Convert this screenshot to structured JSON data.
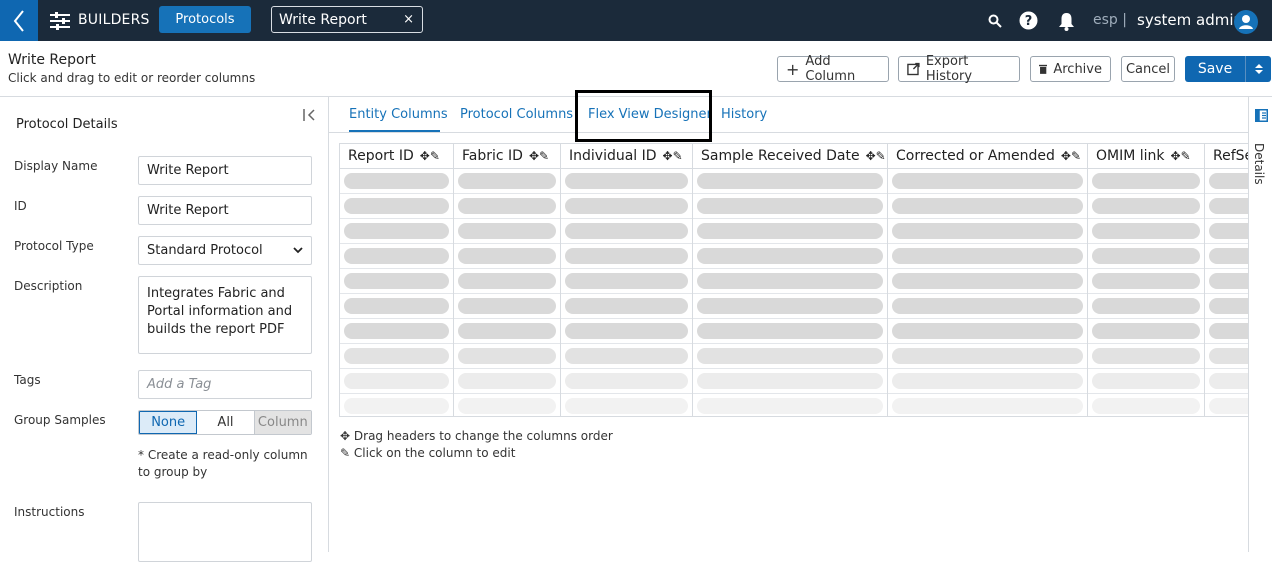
{
  "topbar": {
    "brand": "BUILDERS",
    "section_pill": "Protocols",
    "open_tab": "Write Report",
    "close_glyph": "×",
    "lang": "esp |",
    "user": "system admin",
    "colors": {
      "bar": "#1b2a3a",
      "accent": "#0f67b1"
    }
  },
  "header": {
    "title": "Write Report",
    "subtitle": "Click and drag to edit or reorder columns",
    "buttons": {
      "add_column": "Add Column",
      "export_history": "Export History",
      "archive": "Archive",
      "cancel": "Cancel",
      "save": "Save"
    }
  },
  "details": {
    "heading": "Protocol Details",
    "display_name_label": "Display Name",
    "display_name_value": "Write Report",
    "id_label": "ID",
    "id_value": "Write Report",
    "protocol_type_label": "Protocol Type",
    "protocol_type_value": "Standard Protocol",
    "description_label": "Description",
    "description_value": "Integrates Fabric and Portal information and builds the report PDF",
    "tags_label": "Tags",
    "tags_placeholder": "Add a Tag",
    "group_label": "Group Samples",
    "group_options": [
      "None",
      "All",
      "Column"
    ],
    "group_selected": "None",
    "group_hint": "* Create a read-only column to group by",
    "instructions_label": "Instructions"
  },
  "tabs": [
    "Entity Columns",
    "Protocol Columns",
    "Flex View Designer",
    "History"
  ],
  "active_tab": "Entity Columns",
  "columns": [
    "Report ID",
    "Fabric ID",
    "Individual ID",
    "Sample Received Date",
    "Corrected or Amended",
    "OMIM link",
    "RefSe"
  ],
  "legend": {
    "drag": "Drag headers to change the columns order",
    "edit": "Click on the column to edit"
  },
  "rail": {
    "label": "Details"
  }
}
